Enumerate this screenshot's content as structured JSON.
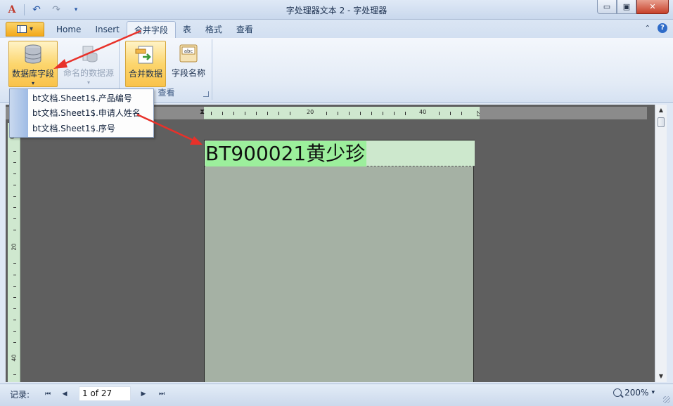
{
  "window": {
    "title": "字处理器文本 2 - 字处理器",
    "controls": {
      "minimize": "▭",
      "restore": "▣",
      "close": "✕"
    }
  },
  "qat": {
    "font_glyph": "A",
    "undo_glyph": "↶",
    "redo_glyph": "↷",
    "more_glyph": "▾"
  },
  "tabs": [
    {
      "label": "Home",
      "active": false
    },
    {
      "label": "Insert",
      "active": false
    },
    {
      "label": "合并字段",
      "active": true
    },
    {
      "label": "表",
      "active": false
    },
    {
      "label": "格式",
      "active": false
    },
    {
      "label": "查看",
      "active": false
    }
  ],
  "tab_icons": {
    "minimize_ribbon": "⌃",
    "help": "?"
  },
  "ribbon": {
    "database_field": {
      "label": "数据库字段",
      "drop": "▾"
    },
    "named_datasource": {
      "label": "命名的数据源",
      "drop": "▾",
      "enabled": false
    },
    "merge_data": {
      "label": "合并数据"
    },
    "field_names": {
      "label": "字段名称",
      "icon_text": "abc"
    },
    "group_view_label": "查看"
  },
  "dropdown": {
    "items": [
      "bt文档.Sheet1$.产品编号",
      "bt文档.Sheet1$.申请人姓名",
      "bt文档.Sheet1$.序号"
    ]
  },
  "ruler": {
    "h_labels": [
      "20",
      "40"
    ],
    "v_labels": [
      "0",
      "20",
      "40"
    ]
  },
  "document": {
    "merged_text": "BT900021黄少珍"
  },
  "statusbar": {
    "record_label": "记录:",
    "nav": {
      "first": "⏮",
      "prev": "◀",
      "next": "▶",
      "last": "⏭"
    },
    "record_value": "1 of 27",
    "zoom": "200%",
    "zoom_drop": "▾"
  },
  "colors": {
    "annotation_arrow": "#e8312a",
    "field_highlight": "#9cef9c",
    "page": "#a5b1a4",
    "workspace": "#5f5f5f",
    "ribbon_hot": "#fcd66e"
  }
}
